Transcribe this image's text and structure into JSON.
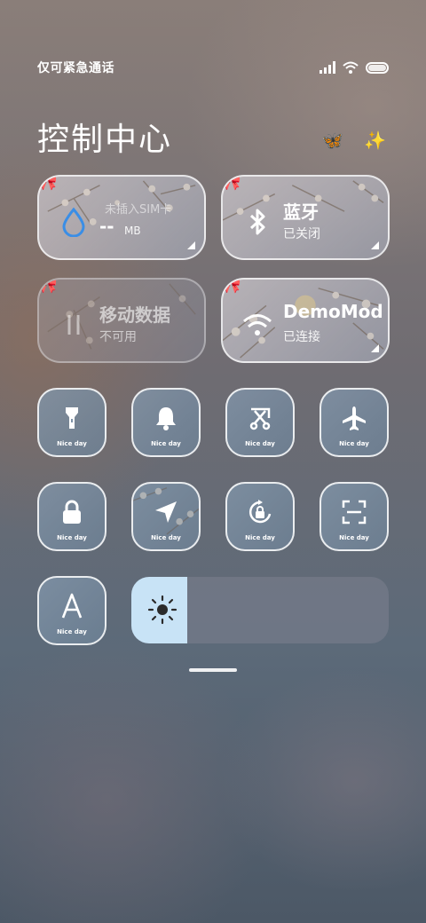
{
  "status_bar": {
    "carrier": "仅可紧急通话"
  },
  "header": {
    "title": "控制中心"
  },
  "tiles": [
    {
      "main": "--",
      "unit": "MB",
      "sub_overlay": "未插入SIM卡"
    },
    {
      "main": "蓝牙",
      "sub": "已关闭"
    },
    {
      "main": "移动数据",
      "sub": "不可用"
    },
    {
      "main": "DemoMod",
      "sub": "已连接"
    }
  ],
  "quick_toggles": {
    "caption": "Nice day",
    "items": [
      "flashlight-icon",
      "bell-icon",
      "screenshot-icon",
      "airplane-icon",
      "lock-icon",
      "location-icon",
      "rotation-lock-icon",
      "scan-icon",
      "font-icon"
    ]
  },
  "colors": {
    "brightness_fill": "#c8e3f6",
    "data_icon": "#3a8ee6"
  }
}
